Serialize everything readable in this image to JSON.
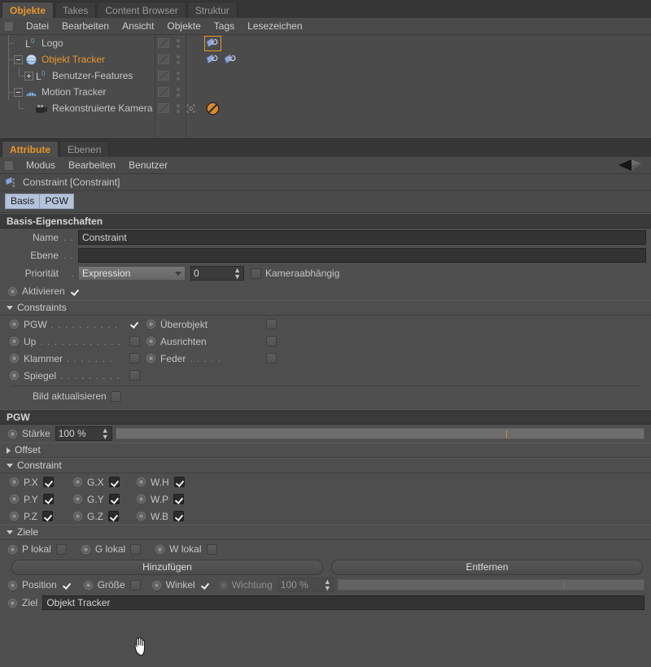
{
  "window": {
    "top_tabs": [
      {
        "label": "Objekte",
        "active": true
      },
      {
        "label": "Takes",
        "active": false
      },
      {
        "label": "Content Browser",
        "active": false
      },
      {
        "label": "Struktur",
        "active": false
      }
    ],
    "menu": [
      "Datei",
      "Bearbeiten",
      "Ansicht",
      "Objekte",
      "Tags",
      "Lesezeichen"
    ]
  },
  "object_manager": {
    "rows": [
      {
        "label": "Logo",
        "icon": "null-object-icon",
        "indent": 0,
        "expander": "none",
        "selected": false,
        "tags": [
          "constraint-tag"
        ],
        "tag_selected": 0
      },
      {
        "label": "Objekt Tracker",
        "icon": "sphere-object-icon",
        "indent": 0,
        "expander": "minus",
        "selected": true,
        "tags": [
          "constraint-tag",
          "constraint-tag"
        ],
        "tag_selected": -1
      },
      {
        "label": "Benutzer-Features",
        "icon": "null-object-icon",
        "indent": 1,
        "expander": "plus",
        "selected": false,
        "tags": [],
        "tag_selected": -1
      },
      {
        "label": "Motion Tracker",
        "icon": "motion-tracker-icon",
        "indent": 0,
        "expander": "minus",
        "selected": false,
        "tags": [],
        "tag_selected": -1
      },
      {
        "label": "Rekonstruierte Kamera",
        "icon": "camera-icon",
        "indent": 1,
        "expander": "none",
        "selected": false,
        "tags": [
          "no-entry-tag"
        ],
        "tag_selected": -1
      }
    ]
  },
  "attribute_manager": {
    "tabs": [
      {
        "label": "Attribute",
        "active": true
      },
      {
        "label": "Ebenen",
        "active": false
      }
    ],
    "menu": [
      "Modus",
      "Bearbeiten",
      "Benutzer"
    ],
    "object_title": "Constraint [Constraint]",
    "mode_buttons": [
      "Basis",
      "PGW"
    ],
    "basis": {
      "header": "Basis-Eigenschaften",
      "name_label": "Name",
      "name_dots": ". . .",
      "name_value": "Constraint",
      "ebene_label": "Ebene",
      "ebene_dots": ". . .",
      "ebene_value": "",
      "prioritaet_label": "Priorität",
      "prioritaet_dots": ".",
      "prioritaet_value": "Expression",
      "prioritaet_number": "0",
      "kameraabhaengig_label": "Kameraabhängig",
      "kameraabhaengig_checked": false,
      "aktivieren_label": "Aktivieren",
      "aktivieren_checked": true
    },
    "constraints_group": {
      "header": "Constraints",
      "left": [
        {
          "label": "PGW",
          "dots": ". . . . . . . . . .",
          "checked": true
        },
        {
          "label": "Up",
          "dots": ". . . . . . . . . . . .",
          "checked": false
        },
        {
          "label": "Klammer",
          "dots": ". . . . . . .",
          "checked": false
        },
        {
          "label": "Spiegel",
          "dots": ". . . . . . . . .",
          "checked": false
        }
      ],
      "right": [
        {
          "label": "Überobjekt",
          "dots": "",
          "checked": false
        },
        {
          "label": "Ausrichten",
          "dots": "",
          "checked": false
        },
        {
          "label": "Feder",
          "dots": ". . . . .",
          "checked": false
        }
      ],
      "bild_aktualisieren_label": "Bild aktualisieren",
      "bild_aktualisieren_checked": false
    },
    "pgw": {
      "header": "PGW",
      "staerke_label": "Stärke",
      "staerke_value": "100 %",
      "staerke_percent": 100,
      "offset_label": "Offset",
      "offset_expanded": false,
      "constraint_label": "Constraint",
      "constraint_expanded": true,
      "axis_rows": [
        [
          {
            "label": "P.X",
            "checked": true
          },
          {
            "label": "G.X",
            "checked": true
          },
          {
            "label": "W.H",
            "checked": true
          }
        ],
        [
          {
            "label": "P.Y",
            "checked": true
          },
          {
            "label": "G.Y",
            "checked": true
          },
          {
            "label": "W.P",
            "checked": true
          }
        ],
        [
          {
            "label": "P.Z",
            "checked": true
          },
          {
            "label": "G.Z",
            "checked": true
          },
          {
            "label": "W.B",
            "checked": true
          }
        ]
      ],
      "ziele_label": "Ziele",
      "ziele_expanded": true,
      "lokal_row": [
        {
          "label": "P lokal",
          "checked": false
        },
        {
          "label": "G lokal",
          "checked": false
        },
        {
          "label": "W lokal",
          "checked": false
        }
      ],
      "add_button": "Hinzufügen",
      "remove_button": "Entfernen",
      "pgw_row": [
        {
          "label": "Position",
          "checked": true,
          "disabled": false
        },
        {
          "label": "Größe",
          "checked": false,
          "disabled": false
        },
        {
          "label": "Winkel",
          "checked": true,
          "disabled": false
        }
      ],
      "wichtung_label": "Wichtung",
      "wichtung_value": "100 %",
      "wichtung_percent": 100,
      "wichtung_disabled": true,
      "ziel_label": "Ziel",
      "ziel_value": "Objekt Tracker"
    }
  },
  "colors": {
    "accent_orange": "#e8962a",
    "panel_bg": "#4e4e4e",
    "section_header_bg": "#3a3a3a",
    "field_bg": "#333333",
    "mode_button_bg": "#b5c3da",
    "tag_blue": "#8fa4d8"
  }
}
